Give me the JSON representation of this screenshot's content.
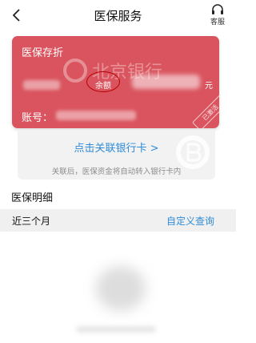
{
  "header": {
    "title": "医保服务",
    "service_label": "客服"
  },
  "card": {
    "title": "医保存折",
    "balance_label": "余额",
    "currency": "元",
    "account_label": "账号：",
    "status_badge": "已激活",
    "bank_watermark": "北京银行",
    "color": "#d9545e"
  },
  "link": {
    "label": "点击关联银行卡 >",
    "note": "关联后，医保资金将自动转入银行卡内",
    "color": "#2f8bd6"
  },
  "details": {
    "title": "医保明细",
    "period": "近三个月",
    "custom_query": "自定义查询"
  },
  "icons": {
    "back": "chevron-left-icon",
    "service": "headset-icon"
  }
}
